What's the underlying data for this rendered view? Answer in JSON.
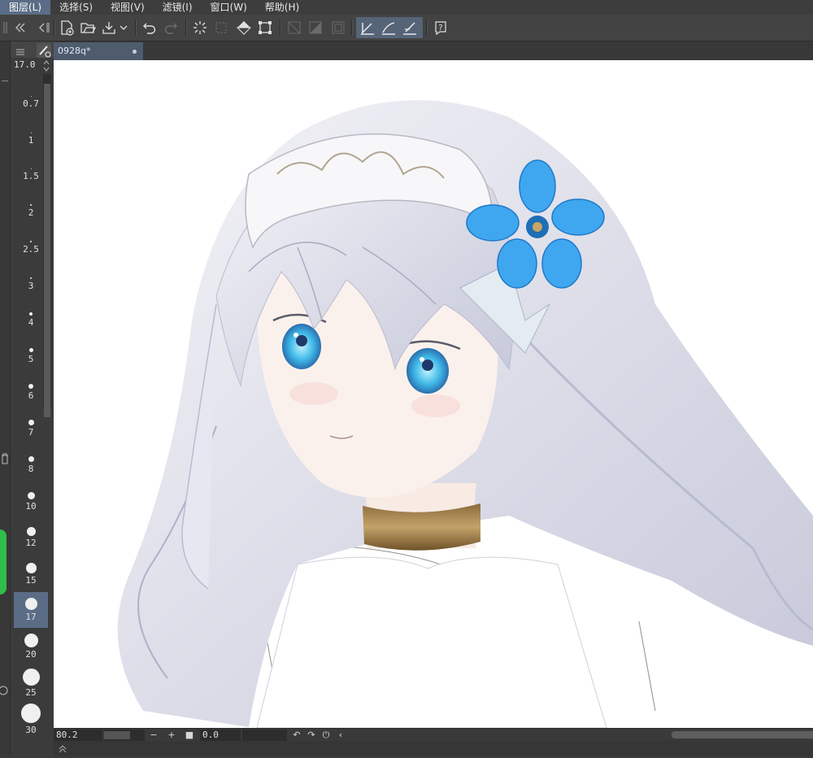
{
  "menubar": {
    "items": [
      {
        "label": "图层(L)",
        "active": true
      },
      {
        "label": "选择(S)",
        "active": false
      },
      {
        "label": "视图(V)",
        "active": false
      },
      {
        "label": "滤镜(I)",
        "active": false
      },
      {
        "label": "窗口(W)",
        "active": false
      },
      {
        "label": "帮助(H)",
        "active": false
      }
    ]
  },
  "document": {
    "tab_title": "0928q*"
  },
  "brush_panel": {
    "current_size": "17.0",
    "sizes": [
      "0.7",
      "1",
      "1.5",
      "2",
      "2.5",
      "3",
      "4",
      "5",
      "6",
      "7",
      "8",
      "10",
      "12",
      "15",
      "17",
      "20",
      "25",
      "30"
    ],
    "selected_size": "17"
  },
  "statusbar": {
    "zoom": "80.2",
    "rotation": "0.0"
  },
  "colors": {
    "accent": "#5b6d86",
    "canvas": "#ffffff",
    "panel": "#3b3b3b"
  }
}
